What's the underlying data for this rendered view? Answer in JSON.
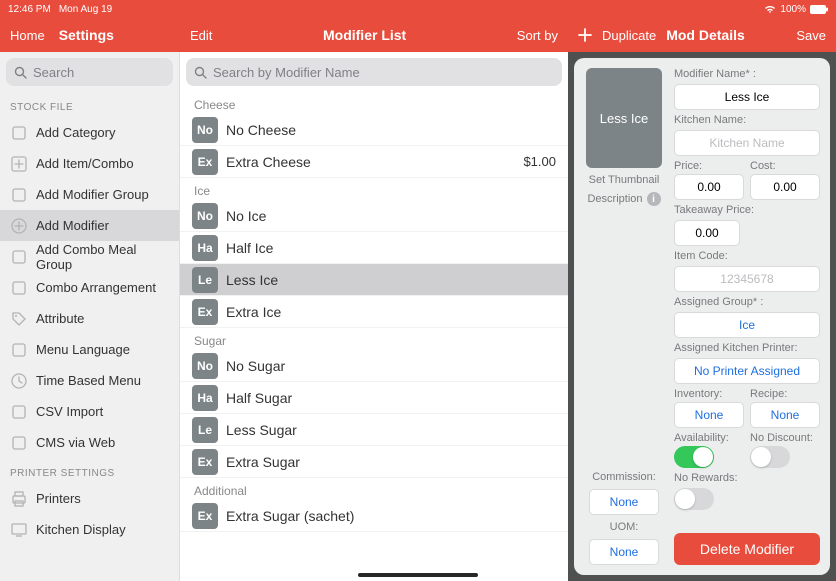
{
  "status": {
    "time": "12:46 PM",
    "date": "Mon Aug 19",
    "battery": "100%"
  },
  "headers": {
    "left": {
      "home": "Home",
      "settings": "Settings"
    },
    "mid": {
      "edit": "Edit",
      "title": "Modifier List",
      "sort": "Sort by"
    },
    "right": {
      "duplicate": "Duplicate",
      "title": "Mod Details",
      "save": "Save"
    }
  },
  "search": {
    "sidebar_ph": "Search",
    "list_ph": "Search by Modifier Name"
  },
  "sidebar": {
    "sections": [
      {
        "title": "STOCK FILE",
        "items": [
          {
            "label": "Add Category",
            "icon": "grid"
          },
          {
            "label": "Add Item/Combo",
            "icon": "plus-box"
          },
          {
            "label": "Add Modifier Group",
            "icon": "layers"
          },
          {
            "label": "Add Modifier",
            "icon": "plus-circle",
            "selected": true
          },
          {
            "label": "Add Combo Meal Group",
            "icon": "grid2"
          },
          {
            "label": "Combo Arrangement",
            "icon": "swap"
          },
          {
            "label": "Attribute",
            "icon": "tag"
          },
          {
            "label": "Menu Language",
            "icon": "lang"
          },
          {
            "label": "Time Based Menu",
            "icon": "clock"
          },
          {
            "label": "CSV Import",
            "icon": "import"
          },
          {
            "label": "CMS via Web",
            "icon": "web"
          }
        ]
      },
      {
        "title": "PRINTER SETTINGS",
        "items": [
          {
            "label": "Printers",
            "icon": "printer"
          },
          {
            "label": "Kitchen Display",
            "icon": "display"
          }
        ]
      }
    ]
  },
  "list": {
    "groups": [
      {
        "title": "Cheese",
        "items": [
          {
            "badge": "No",
            "label": "No Cheese"
          },
          {
            "badge": "Ex",
            "label": "Extra Cheese",
            "price": "$1.00"
          }
        ]
      },
      {
        "title": "Ice",
        "items": [
          {
            "badge": "No",
            "label": "No Ice"
          },
          {
            "badge": "Ha",
            "label": "Half Ice"
          },
          {
            "badge": "Le",
            "label": "Less Ice",
            "selected": true
          },
          {
            "badge": "Ex",
            "label": "Extra Ice"
          }
        ]
      },
      {
        "title": "Sugar",
        "items": [
          {
            "badge": "No",
            "label": "No Sugar"
          },
          {
            "badge": "Ha",
            "label": "Half Sugar"
          },
          {
            "badge": "Le",
            "label": "Less Sugar"
          },
          {
            "badge": "Ex",
            "label": "Extra Sugar"
          }
        ]
      },
      {
        "title": "Additional",
        "items": [
          {
            "badge": "Ex",
            "label": "Extra Sugar (sachet)"
          }
        ]
      }
    ]
  },
  "detail": {
    "thumb_label": "Less Ice",
    "set_thumb": "Set Thumbnail",
    "description": "Description",
    "labels": {
      "name": "Modifier Name* :",
      "kitchen": "Kitchen Name:",
      "price": "Price:",
      "cost": "Cost:",
      "takeaway": "Takeaway Price:",
      "item_code": "Item Code:",
      "assigned_group": "Assigned Group* :",
      "commission": "Commission:",
      "kitchen_printer": "Assigned Kitchen Printer:",
      "uom": "UOM:",
      "inventory": "Inventory:",
      "recipe": "Recipe:",
      "availability": "Availability:",
      "no_discount": "No Discount:",
      "no_rewards": "No Rewards:"
    },
    "values": {
      "name": "Less Ice",
      "kitchen_ph": "Kitchen Name",
      "price": "0.00",
      "cost": "0.00",
      "takeaway": "0.00",
      "item_code_ph": "12345678",
      "assigned_group": "Ice",
      "commission": "None",
      "kitchen_printer": "No Printer Assigned",
      "uom": "None",
      "inventory": "None",
      "recipe": "None",
      "availability_on": true,
      "no_discount_on": false,
      "no_rewards_on": false
    },
    "delete": "Delete Modifier"
  }
}
